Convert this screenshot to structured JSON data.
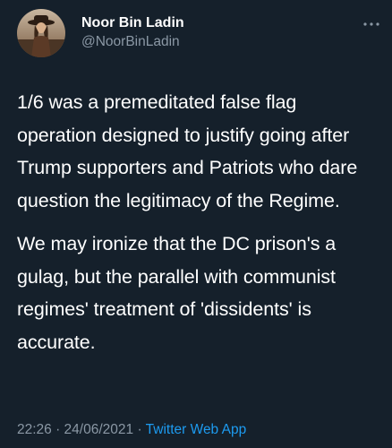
{
  "tweet": {
    "author": {
      "display_name": "Noor Bin Ladin",
      "handle": "@NoorBinLadin",
      "avatar_icon": "profile-photo"
    },
    "more_icon": "ellipsis-icon",
    "paragraphs": [
      "1/6 was a premeditated false flag operation designed to justify going after Trump supporters and Patriots who dare question the legitimacy of the Regime.",
      "We may ironize that the DC prison's a gulag, but the parallel with communist regimes' treatment of 'dissidents' is accurate."
    ],
    "timestamp": "22:26 · 24/06/2021",
    "separator": " · ",
    "source_app": "Twitter Web App"
  },
  "colors": {
    "background": "#15202b",
    "text": "#ffffff",
    "secondary_text": "#8b98a5",
    "accent": "#1d9bf0"
  }
}
